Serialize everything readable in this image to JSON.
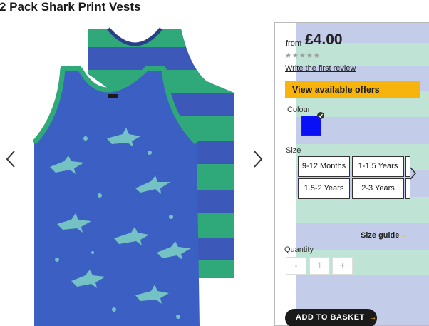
{
  "product": {
    "title": "2 Pack Shark Print Vests"
  },
  "colors": {
    "offers_yellow": "#f6b40c",
    "swatch_blue": "#0a10f5",
    "vest_blue": "#3c58b8",
    "vest_green": "#2fa87a",
    "shark_print": "#7fd4c4"
  },
  "icons": {
    "prev": "chevron-left-icon",
    "next": "chevron-right-icon",
    "size_next": "chevron-right-icon",
    "swatch_selected": "checkmark-icon"
  },
  "purchase": {
    "from_label": "from",
    "price": "£4.00",
    "stars": "★★★★★",
    "write_review": "Write the first review",
    "offers_button": "View available offers",
    "colour_label": "Colour",
    "size_label": "Size",
    "sizes": [
      "9-12 Months",
      "1-1.5 Years",
      "1.5-2 Years",
      "2-3 Years"
    ],
    "size_guide": "Size guide",
    "size_guide_arrow": "→",
    "quantity_label": "Quantity",
    "qty_minus": "-",
    "qty_value": "1",
    "qty_plus": "+",
    "basket_button": "ADD TO BASKET",
    "basket_arrow": "→"
  }
}
